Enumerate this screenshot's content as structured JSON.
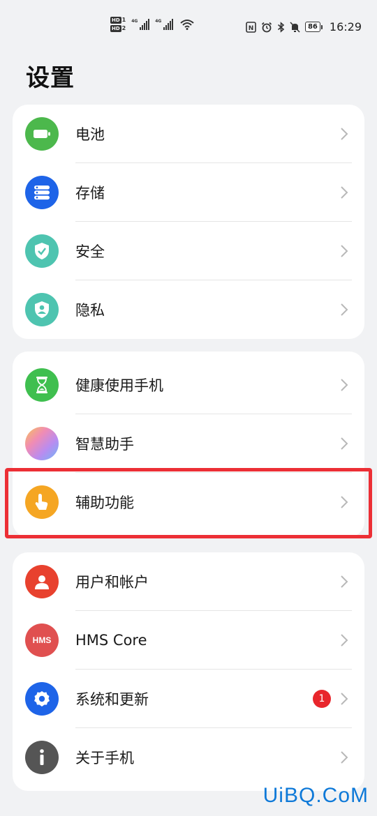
{
  "status_bar": {
    "sim1_label": "HD",
    "sim1_num": "1",
    "sim2_label": "HD",
    "sim2_num": "2",
    "net1": "4G",
    "net2": "4G",
    "battery": "86",
    "time": "16:29",
    "icons": [
      "nfc-icon",
      "alarm-icon",
      "bluetooth-icon",
      "mute-icon"
    ]
  },
  "page": {
    "title": "设置"
  },
  "groups": [
    {
      "items": [
        {
          "label": "电池",
          "icon": "battery-icon",
          "color": "#4cb84c"
        },
        {
          "label": "存储",
          "icon": "storage-icon",
          "color": "#1e64e8"
        },
        {
          "label": "安全",
          "icon": "shield-icon",
          "color": "#4ec4b0"
        },
        {
          "label": "隐私",
          "icon": "privacy-icon",
          "color": "#4ec4b0"
        }
      ]
    },
    {
      "items": [
        {
          "label": "健康使用手机",
          "icon": "hourglass-icon",
          "color": "#3fbf4f"
        },
        {
          "label": "智慧助手",
          "icon": "assistant-icon",
          "color": "#c58cf0"
        },
        {
          "label": "辅助功能",
          "icon": "touch-hand-icon",
          "color": "#f5a623"
        }
      ]
    },
    {
      "items": [
        {
          "label": "用户和帐户",
          "icon": "user-icon",
          "color": "#e8412e"
        },
        {
          "label": "HMS Core",
          "icon": "hms-icon",
          "color": "#e05050",
          "icon_text": "HMS"
        },
        {
          "label": "系统和更新",
          "icon": "gear-icon",
          "color": "#1e64e8",
          "badge": "1"
        },
        {
          "label": "关于手机",
          "icon": "info-icon",
          "color": "#555555"
        }
      ]
    }
  ],
  "watermark": "UiBQ.CoM",
  "highlight_color": "#ec2f35"
}
